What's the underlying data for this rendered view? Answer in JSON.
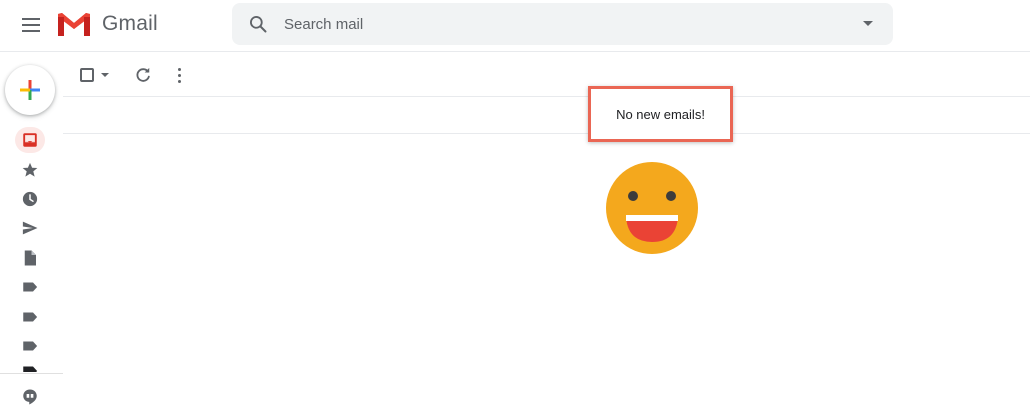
{
  "header": {
    "brand": "Gmail",
    "search": {
      "placeholder": "Search mail",
      "value": ""
    }
  },
  "icons": {
    "menu": "hamburger-menu-icon",
    "logo": "gmail-m-logo",
    "search": "search-icon",
    "search_options": "caret-down-icon",
    "compose": "plus-icon",
    "rail": [
      "inbox-icon",
      "star-icon",
      "clock-icon",
      "send-icon",
      "document-icon",
      "label-icon",
      "label-icon",
      "label-icon",
      "label-icon",
      "hangouts-icon"
    ],
    "toolbar": [
      "checkbox-icon",
      "caret-down-icon",
      "refresh-icon",
      "more-vert-icon"
    ],
    "empty_state": "smiley-face-icon"
  },
  "main": {
    "empty_message": "No new emails!"
  },
  "colors": {
    "accent_red": "#d93025",
    "highlight_border": "#ea6654",
    "smiley_face": "#f4a81d",
    "smiley_mouth": "#ea4335"
  }
}
